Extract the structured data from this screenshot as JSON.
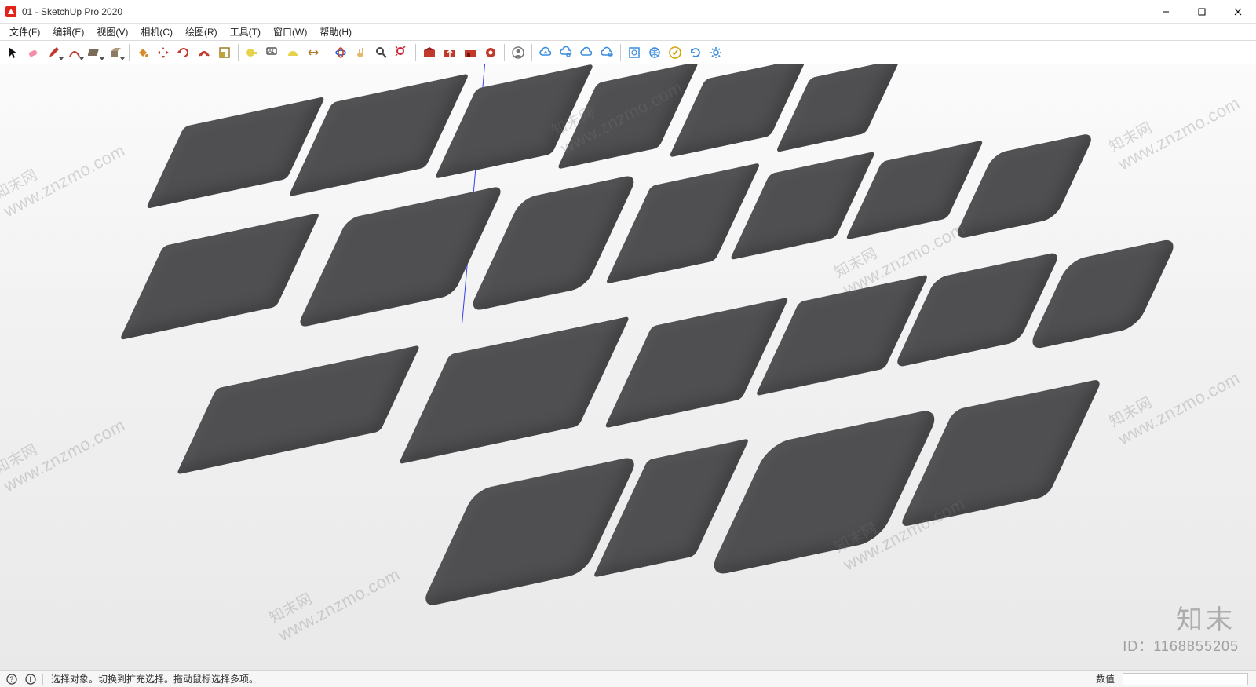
{
  "window": {
    "title": "01 - SketchUp Pro 2020"
  },
  "menus": [
    "文件(F)",
    "编辑(E)",
    "视图(V)",
    "相机(C)",
    "绘图(R)",
    "工具(T)",
    "窗口(W)",
    "帮助(H)"
  ],
  "toolbar_groups": [
    [
      "select",
      "eraser",
      "pencil",
      "arc",
      "rectangle",
      "pushpull"
    ],
    [
      "bucket",
      "move",
      "rotate",
      "offset",
      "scale"
    ],
    [
      "tape",
      "text",
      "protractor",
      "dimension"
    ],
    [
      "orbit",
      "pan",
      "zoom",
      "zoom-extents"
    ],
    [
      "warehouse-get",
      "warehouse-share",
      "warehouse",
      "extension-warehouse"
    ],
    [
      "profile"
    ],
    [
      "cloud1",
      "cloud2",
      "cloud3",
      "cloud4"
    ],
    [
      "geo",
      "model-info",
      "new-tab",
      "refresh",
      "settings"
    ]
  ],
  "toolbar_dropdowns": [
    "pencil",
    "arc",
    "rectangle",
    "pushpull"
  ],
  "status": {
    "hint": "选择对象。切换到扩充选择。拖动鼠标选择多项。",
    "measure_label": "数值"
  },
  "overlay": {
    "watermark_text": "www.znzmo.com",
    "watermark_cn": "知末网",
    "brand": "知末",
    "id": "ID：1168855205"
  }
}
